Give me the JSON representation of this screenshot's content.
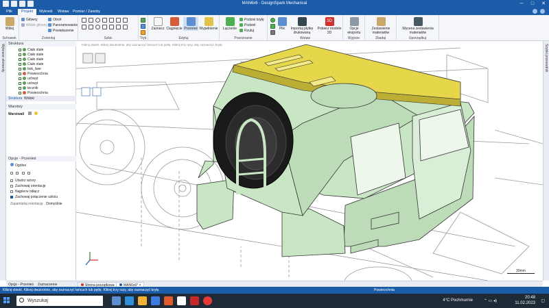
{
  "window": {
    "title": "MAN6x6 - DesignSpark Mechanical",
    "controls": [
      "─",
      "□",
      "✕"
    ]
  },
  "menu": {
    "items": [
      "Plik",
      "Projekt",
      "Wykreśl",
      "Wstaw",
      "Pomiar / Zasoby"
    ],
    "active": "Projekt"
  },
  "ribbon": {
    "groups": {
      "clipboard": "Schowek",
      "orient": "Zorientuj",
      "sketch": "Szkic",
      "mode": "Tryb",
      "edit": "Edytuj",
      "intersect": "Przecinanie",
      "insert": "Wstaw",
      "output": "Wyjście",
      "bom": "Zbadaj",
      "order": "Uporządkuj"
    },
    "buttons": {
      "paste": "Wklej",
      "orbit": "Obrót",
      "pan": "Panoramowanie",
      "zoom": "Powiększenie",
      "home": "Główny",
      "view": "Widok główny",
      "select": "Zaznacz",
      "pull": "Ciągnięcie",
      "move": "Przenieś",
      "fill": "Wypełnienie",
      "combine": "Łączenie",
      "split_body": "Podziel bryłę",
      "split": "Podziel",
      "shell": "Rzutuj",
      "file": "Plik",
      "import": "Importuj płytkę drukowaną",
      "download3d": "Pobierz modele 3D",
      "options": "Opcje eksportu",
      "bom": "Zestawienie materiałów",
      "quote": "Wycena zestawienia materiałów"
    }
  },
  "left_tab": "Wybrane elementy",
  "right_tab": "Szybki przewodnik",
  "structure": {
    "title": "Struktura",
    "items": [
      "Ciało stałe",
      "Ciało stałe",
      "Ciało stałe",
      "Ciało stałe",
      "bok_lwer",
      "Powierzchnia",
      "uchwyt",
      "uchwyt",
      "tecznik",
      "Powierzchnia"
    ],
    "tabs": [
      "Struktura",
      "Widoki"
    ]
  },
  "layers": {
    "title": "Warstwy",
    "name": "Warstwa0"
  },
  "options": {
    "title": "Opcje - Przenieś",
    "group": "Ogólne",
    "items": [
      {
        "label": "Utwórz wzory",
        "checked": false
      },
      {
        "label": "Zachowaj orientację",
        "checked": false
      },
      {
        "label": "Najpierw odłącz",
        "checked": false
      },
      {
        "label": "Zachowaj połączenie szkicu",
        "checked": true
      }
    ],
    "orientation_label": "Zapamiętaj orientację",
    "orientation_value": "Domyślnie"
  },
  "bottom_tabs": [
    "Opcje - Przenieś",
    "Zaznaczenie"
  ],
  "viewport": {
    "hint": "Kliknij obiekt. Kliknij dwukrotnie, aby zaznaczyć łańcuch lub pętlę. Kliknij trzy razy, aby zaznaczyć bryłę.",
    "scale": "30mm"
  },
  "doc_tabs": [
    "Strona początkowa",
    "MAN6x6*"
  ],
  "status": {
    "hint": "Kliknij obiekt. Kliknij dwukrotnie, aby zaznaczyć łańcuch lub pętlę. Kliknij trzy razy, aby zaznaczyć bryłę.",
    "selection": "Powierzchnia"
  },
  "taskbar": {
    "search": "Wyszukaj",
    "weather": "4°C Pochmurnie",
    "time": "20:48",
    "date": "11.02.2023"
  },
  "colors": {
    "accent": "#1b5ca8",
    "roof": "#e5d64a",
    "body": "#c8e6c4",
    "outline": "#333333"
  }
}
